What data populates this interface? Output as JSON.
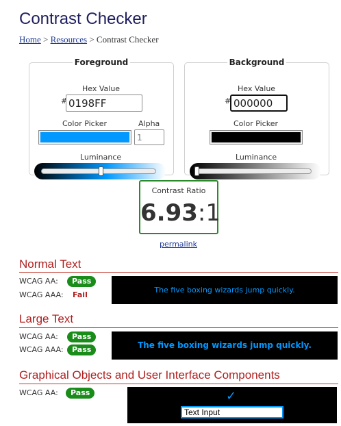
{
  "page": {
    "title": "Contrast Checker",
    "breadcrumb": {
      "home": "Home",
      "sep1": ">",
      "resources": "Resources",
      "sep2": ">",
      "current": "Contrast Checker"
    }
  },
  "foreground": {
    "legend": "Foreground",
    "hex_label": "Hex Value",
    "hash": "#",
    "hex_value": "0198FF",
    "picker_label": "Color Picker",
    "alpha_label": "Alpha",
    "alpha_value": "1",
    "luminance_label": "Luminance",
    "luminance_fraction": 0.52,
    "color": "#0198FF"
  },
  "background": {
    "legend": "Background",
    "hex_label": "Hex Value",
    "hash": "#",
    "hex_value": "000000",
    "picker_label": "Color Picker",
    "luminance_label": "Luminance",
    "luminance_fraction": 0.0,
    "color": "#000000"
  },
  "contrast": {
    "label": "Contrast Ratio",
    "value": "6.93",
    "suffix": ":1",
    "permalink": "permalink"
  },
  "normal_text": {
    "title": "Normal Text",
    "aa_label": "WCAG AA:",
    "aa_result": "Pass",
    "aaa_label": "WCAG AAA:",
    "aaa_result": "Fail",
    "sample": "The five boxing wizards jump quickly."
  },
  "large_text": {
    "title": "Large Text",
    "aa_label": "WCAG AA:",
    "aa_result": "Pass",
    "aaa_label": "WCAG AAA:",
    "aaa_result": "Pass",
    "sample": "The five boxing wizards jump quickly."
  },
  "graphical": {
    "title": "Graphical Objects and User Interface Components",
    "aa_label": "WCAG AA:",
    "aa_result": "Pass",
    "checkmark": "✓",
    "input_value": "Text Input"
  },
  "colors": {
    "pass": "#1a8c1a",
    "fail": "#b11f1f",
    "heading": "#1f1f5f",
    "section": "#b11f1f"
  }
}
